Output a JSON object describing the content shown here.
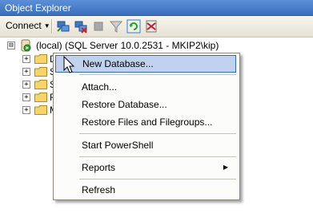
{
  "window": {
    "title": "Object Explorer"
  },
  "toolbar": {
    "connect_label": "Connect",
    "dropdown_arrow": "▼",
    "icons": [
      "connect-object-explorer-icon",
      "disconnect-icon",
      "stop-icon",
      "filter-icon",
      "refresh-icon",
      "registered-servers-icon"
    ]
  },
  "tree": {
    "root": {
      "label": "(local) (SQL Server 10.0.2531 - MKIP2\\kip)",
      "expander": "⊟"
    },
    "children": [
      {
        "label": "D",
        "expander": "+"
      },
      {
        "label": "S",
        "expander": "+"
      },
      {
        "label": "S",
        "expander": "+"
      },
      {
        "label": "R",
        "expander": "+"
      },
      {
        "label": "M",
        "expander": "+"
      }
    ]
  },
  "context_menu": {
    "items": [
      {
        "label": "New Database...",
        "highlighted": true
      },
      {
        "label": "Attach..."
      },
      {
        "label": "Restore Database..."
      },
      {
        "label": "Restore Files and Filegroups..."
      },
      {
        "label": "Start PowerShell"
      },
      {
        "label": "Reports",
        "submenu_arrow": "▶"
      },
      {
        "label": "Refresh"
      }
    ]
  },
  "colors": {
    "title_bar": "#3a6fbf",
    "menu_highlight": "#c1d2ee",
    "menu_highlight_border": "#316ac5"
  }
}
